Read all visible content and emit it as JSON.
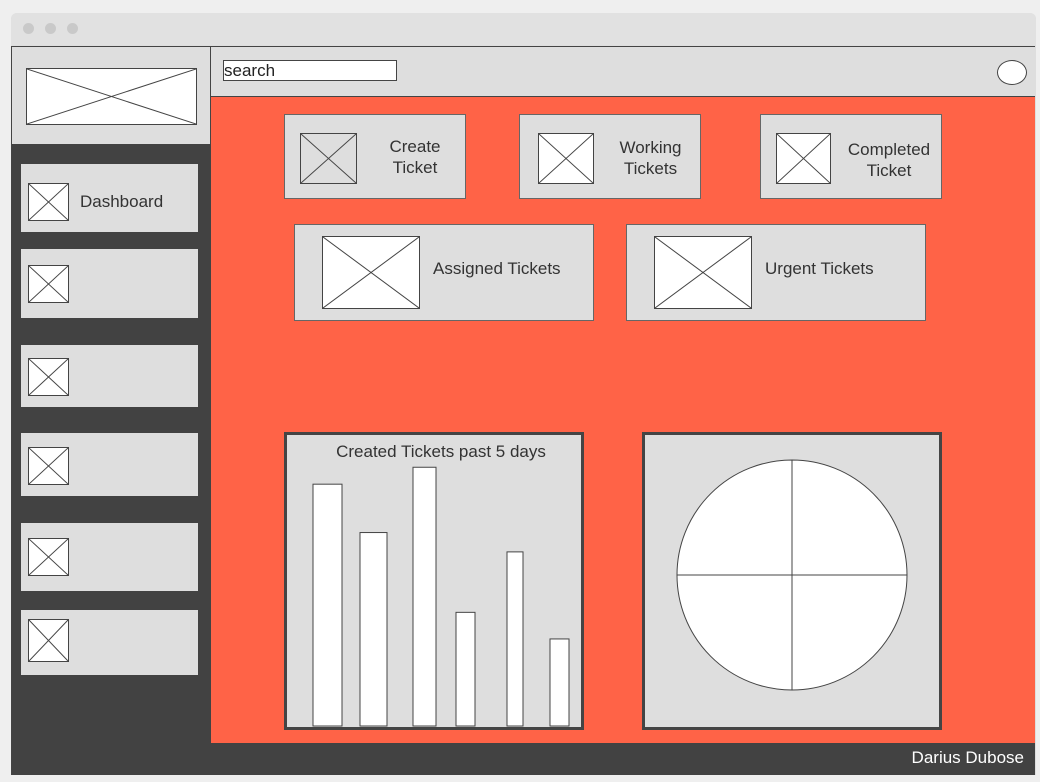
{
  "window": {
    "controls": [
      "close",
      "minimize",
      "maximize"
    ]
  },
  "header": {
    "search_value": "search",
    "avatar_icon": "user-avatar-icon"
  },
  "sidebar": {
    "logo_icon": "logo-placeholder-icon",
    "items": [
      {
        "label": "Dashboard",
        "icon": "dashboard-placeholder-icon"
      },
      {
        "label": "",
        "icon": "placeholder-icon"
      },
      {
        "label": "",
        "icon": "placeholder-icon"
      },
      {
        "label": "",
        "icon": "placeholder-icon"
      },
      {
        "label": "",
        "icon": "placeholder-icon"
      },
      {
        "label": "",
        "icon": "placeholder-icon"
      }
    ]
  },
  "cards": {
    "create": "Create Ticket",
    "working": "Working Tickets",
    "completed": "Completed Ticket",
    "assigned": "Assigned Tickets",
    "urgent": "Urgent Tickets"
  },
  "chart_data": [
    {
      "type": "bar",
      "title": "Created Tickets past 5 days",
      "categories": [
        "",
        "",
        "",
        "",
        "",
        ""
      ],
      "values": [
        100,
        80,
        107,
        47,
        72,
        36
      ],
      "xlabel": "",
      "ylabel": "",
      "ylim": [
        0,
        110
      ],
      "grid": false
    },
    {
      "type": "pie",
      "title": "",
      "labels": [
        "",
        "",
        "",
        ""
      ],
      "values": [
        25,
        25,
        25,
        25
      ]
    }
  ],
  "footer": {
    "user_name": "Darius Dubose"
  },
  "colors": {
    "accent": "#ff6347",
    "sidebar": "#424242",
    "panel": "#dedede"
  }
}
